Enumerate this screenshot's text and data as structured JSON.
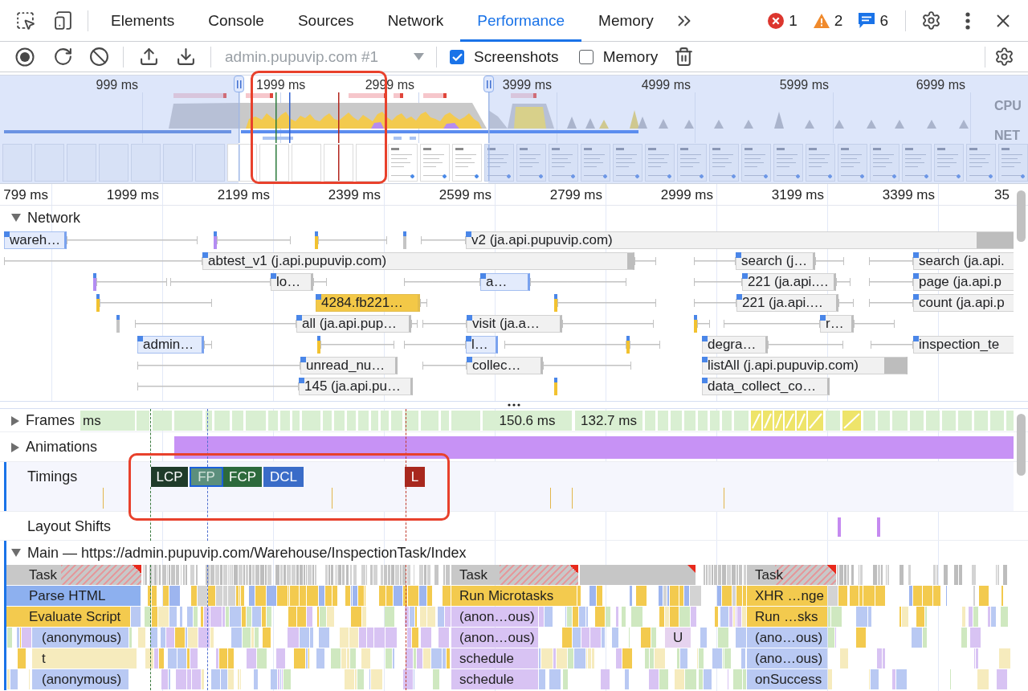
{
  "devtools_tabs": {
    "tabs": [
      {
        "label": "Elements",
        "selected": false
      },
      {
        "label": "Console",
        "selected": false
      },
      {
        "label": "Sources",
        "selected": false
      },
      {
        "label": "Network",
        "selected": false
      },
      {
        "label": "Performance",
        "selected": true
      },
      {
        "label": "Memory",
        "selected": false
      }
    ],
    "issue_counts": [
      {
        "kind": "error",
        "count": "1"
      },
      {
        "kind": "warning",
        "count": "2"
      },
      {
        "kind": "info",
        "count": "6"
      }
    ]
  },
  "toolbar": {
    "target": {
      "value": "admin.pupuvip.com #1",
      "disabled": true
    },
    "checkboxes": [
      {
        "label": "Screenshots",
        "checked": true
      },
      {
        "label": "Memory",
        "checked": false
      }
    ]
  },
  "overview": {
    "time_labels": [
      "999 ms",
      "1999 ms",
      "2999 ms",
      "3999 ms",
      "4999 ms",
      "5999 ms",
      "6999 ms"
    ],
    "lanes": [
      "CPU",
      "NET"
    ]
  },
  "ruler": {
    "labels": [
      "799 ms",
      "1999 ms",
      "2199 ms",
      "2399 ms",
      "2599 ms",
      "2799 ms",
      "2999 ms",
      "3199 ms",
      "3399 ms",
      "35"
    ]
  },
  "network": {
    "title": "Network",
    "expanded": true,
    "rows": [
      [
        {
          "label": "wareh…",
          "kind": "document"
        },
        {
          "label": "v2 (ja.api.pupuvip.com)",
          "kind": "fetch"
        }
      ],
      [
        {
          "label": "abtest_v1 (j.api.pupuvip.com)",
          "kind": "fetch"
        },
        {
          "label": "search (j…",
          "kind": "fetch"
        },
        {
          "label": "search (ja.api.",
          "kind": "fetch"
        }
      ],
      [
        {
          "label": "lo…",
          "kind": "fetch"
        },
        {
          "label": "a…",
          "kind": "document"
        },
        {
          "label": "221 (ja.api.…",
          "kind": "fetch"
        },
        {
          "label": "page (ja.api.p",
          "kind": "fetch"
        }
      ],
      [
        {
          "label": "4284.fb221…",
          "kind": "script"
        },
        {
          "label": "221 (ja.api.…",
          "kind": "fetch"
        },
        {
          "label": "count (ja.api.p",
          "kind": "fetch"
        }
      ],
      [
        {
          "label": "all (ja.api.pup…",
          "kind": "fetch"
        },
        {
          "label": "visit (ja.a…",
          "kind": "fetch"
        },
        {
          "label": "r…",
          "kind": "fetch"
        }
      ],
      [
        {
          "label": "admin…",
          "kind": "document"
        },
        {
          "label": "l…",
          "kind": "document"
        },
        {
          "label": "degra…",
          "kind": "fetch"
        },
        {
          "label": "inspection_te",
          "kind": "fetch"
        }
      ],
      [
        {
          "label": "unread_nu…",
          "kind": "fetch"
        },
        {
          "label": "collec…",
          "kind": "fetch"
        },
        {
          "label": "listAll (j.api.pupuvip.com)",
          "kind": "fetch"
        }
      ],
      [
        {
          "label": "145 (ja.api.pu…",
          "kind": "fetch"
        },
        {
          "label": "data_collect_co…",
          "kind": "fetch"
        }
      ]
    ]
  },
  "tracks": {
    "frames": {
      "title": "Frames",
      "expanded": false,
      "frames": [
        {
          "label": "ms"
        },
        {
          "label": "150.6 ms"
        },
        {
          "label": "132.7 ms"
        }
      ]
    },
    "animations": {
      "title": "Animations",
      "expanded": false
    },
    "timings": {
      "title": "Timings",
      "markers": [
        {
          "label": "LCP",
          "color": "#1f3b29",
          "selected": false
        },
        {
          "label": "FP",
          "color": "#5c8f7d",
          "selected": true
        },
        {
          "label": "FCP",
          "color": "#2d6a3c",
          "selected": false
        },
        {
          "label": "DCL",
          "color": "#3a6cc8",
          "selected": false
        },
        {
          "label": "L",
          "color": "#a8281e",
          "selected": false
        }
      ]
    },
    "layout_shifts": {
      "title": "Layout Shifts"
    },
    "main": {
      "title": "Main — https://admin.pupuvip.com/Warehouse/InspectionTask/Index",
      "expanded": true,
      "rows": [
        [
          {
            "label": "Task",
            "color": "#c8c8c8",
            "long_task": true
          },
          {
            "label": "Task",
            "color": "#c8c8c8",
            "long_task": true
          },
          {
            "label": "Task",
            "color": "#c8c8c8",
            "long_task": true
          }
        ],
        [
          {
            "label": "Parse HTML",
            "color": "#8db0ef"
          },
          {
            "label": "Run Microtasks",
            "color": "#f3ca4e"
          },
          {
            "label": "XHR …nge",
            "color": "#f3ca4e"
          }
        ],
        [
          {
            "label": "Evaluate Script",
            "color": "#f3ca4e"
          },
          {
            "label": "(anon…ous)",
            "color": "#d8c3f3"
          },
          {
            "label": "Run …sks",
            "color": "#f3ca4e"
          }
        ],
        [
          {
            "label": "(anonymous)",
            "color": "#b9c9f3"
          },
          {
            "label": "(anon…ous)",
            "color": "#d8c3f3"
          },
          {
            "label": "U",
            "color": "#e6d3ef"
          },
          {
            "label": "(ano…ous)",
            "color": "#b9c9f3"
          }
        ],
        [
          {
            "label": "t",
            "color": "#f6ebbd"
          },
          {
            "label": "schedule",
            "color": "#d8c3f3"
          },
          {
            "label": "(ano…ous)",
            "color": "#b9c9f3"
          }
        ],
        [
          {
            "label": "(anonymous)",
            "color": "#b9c9f3"
          },
          {
            "label": "schedule",
            "color": "#d8c3f3"
          },
          {
            "label": "onSuccess",
            "color": "#b9c9f3"
          }
        ]
      ]
    }
  },
  "annotations": [
    {
      "kind": "outline"
    },
    {
      "kind": "outline"
    }
  ]
}
